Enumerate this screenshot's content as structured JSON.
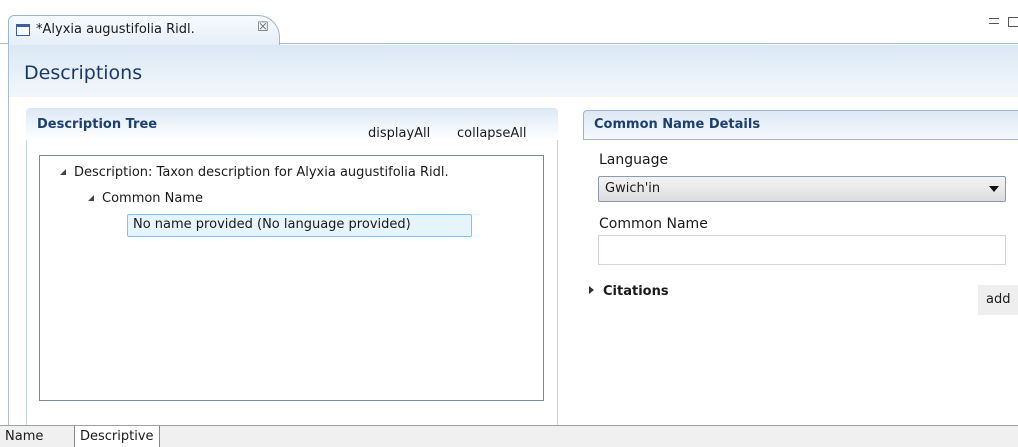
{
  "editor_tab": {
    "title": "*Alyxia augustifolia Ridl.",
    "close_glyph": "☒"
  },
  "form": {
    "title": "Descriptions"
  },
  "description_tree": {
    "section_title": "Description Tree",
    "display_all_label": "displayAll",
    "collapse_all_label": "collapseAll",
    "nodes": [
      {
        "label": "Description: Taxon description for Alyxia augustifolia Ridl.",
        "expanded": true,
        "level": 0
      },
      {
        "label": "Common Name",
        "expanded": true,
        "level": 1
      },
      {
        "label": "No name provided (No language provided)",
        "selected": true,
        "level": 2
      }
    ]
  },
  "details": {
    "section_title": "Common Name Details",
    "language_label": "Language",
    "language_value": "Gwich'in",
    "common_name_label": "Common Name",
    "common_name_value": "",
    "citations_label": "Citations",
    "add_label": "add"
  },
  "page_tabs": [
    {
      "label": "Name",
      "active": false
    },
    {
      "label": "Descriptive",
      "active": true
    }
  ],
  "icons": {
    "editor": "document-icon",
    "close": "close-icon",
    "expand": "triangle-down-icon",
    "collapse": "triangle-right-icon",
    "dropdown": "chevron-down-icon"
  },
  "colors": {
    "accent": "#1d3f6e",
    "selection_border": "#7fc4ec",
    "selection_fill": "#e6f4fc"
  }
}
